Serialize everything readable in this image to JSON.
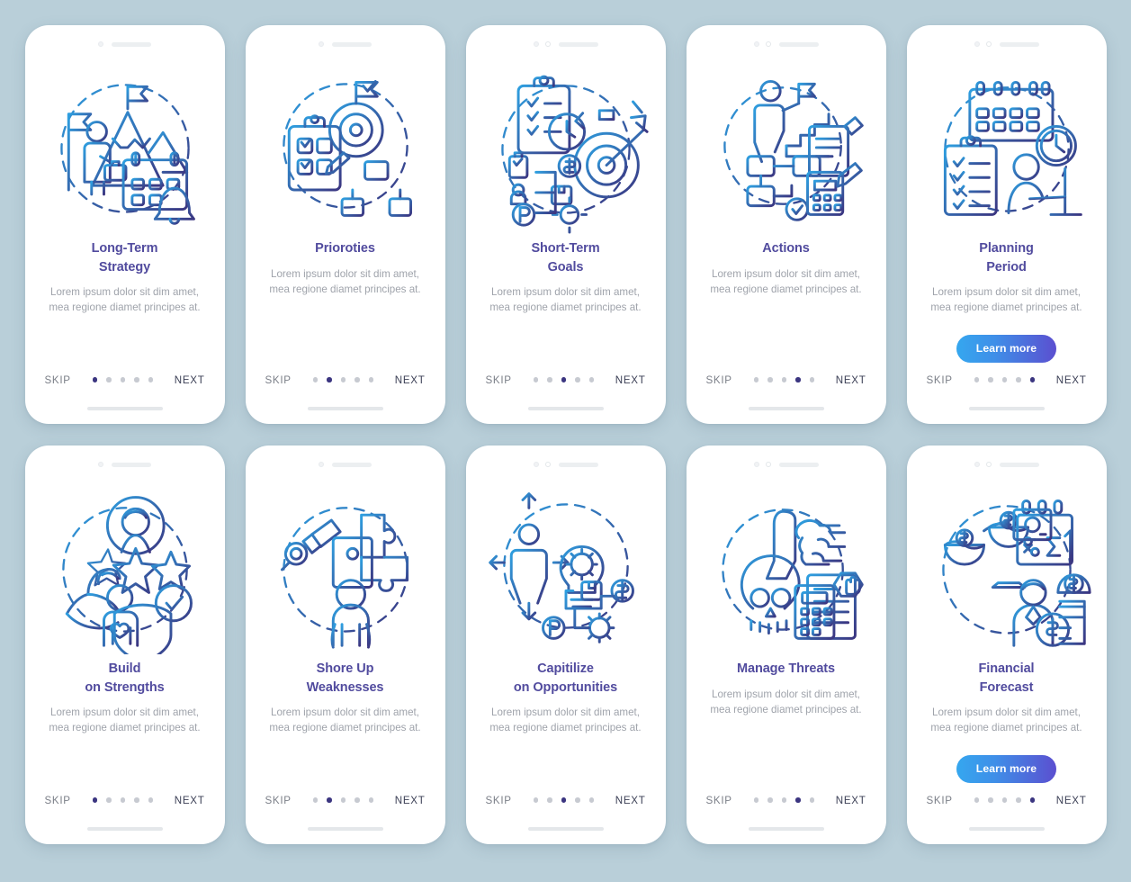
{
  "page": {
    "background_color": "#b9cfd9",
    "card_background": "#ffffff",
    "title_color": "#514b9e",
    "desc_color": "#9fa3ab",
    "active_dot_color": "#3b3580",
    "inactive_dot_color": "#c7cad1",
    "cta_gradient_start": "#35a7ef",
    "cta_gradient_end": "#5b4fd0",
    "illustration_stroke_start": "#2e9fe0",
    "illustration_stroke_end": "#3b3580"
  },
  "common": {
    "skip_label": "SKIP",
    "next_label": "NEXT",
    "learn_more_label": "Learn more",
    "description": "Lorem ipsum dolor sit dim amet, mea regione diamet principes at.",
    "dot_count": 5
  },
  "screens": [
    {
      "id": "long-term-strategy",
      "title": "Long-Term Strategy",
      "title_lines": [
        "Long-Term",
        "Strategy"
      ],
      "description": "Lorem ipsum dolor sit dim amet, mea regione diamet principes at.",
      "skip_label": "SKIP",
      "next_label": "NEXT",
      "active_dot": 1,
      "dot_count": 5,
      "camera_dots": 1,
      "has_learn_more": false,
      "learn_more_label": "",
      "illustration": "mountain-flag-calendar-icon"
    },
    {
      "id": "prioroties",
      "title": "Prioroties",
      "title_lines": [
        "Prioroties"
      ],
      "description": "Lorem ipsum dolor sit dim amet, mea regione diamet principes at.",
      "skip_label": "SKIP",
      "next_label": "NEXT",
      "active_dot": 2,
      "dot_count": 5,
      "camera_dots": 1,
      "has_learn_more": false,
      "learn_more_label": "",
      "illustration": "target-flag-checklist-hierarchy-icon"
    },
    {
      "id": "short-term-goals",
      "title": "Short-Term Goals",
      "title_lines": [
        "Short-Term",
        "Goals"
      ],
      "description": "Lorem ipsum dolor sit dim amet, mea regione diamet principes at.",
      "skip_label": "SKIP",
      "next_label": "NEXT",
      "active_dot": 3,
      "dot_count": 5,
      "camera_dots": 2,
      "has_learn_more": false,
      "learn_more_label": "",
      "illustration": "clipboard-clock-stopwatch-target-icon"
    },
    {
      "id": "actions",
      "title": "Actions",
      "title_lines": [
        "Actions"
      ],
      "description": "Lorem ipsum dolor sit dim amet, mea regione diamet principes at.",
      "skip_label": "SKIP",
      "next_label": "NEXT",
      "active_dot": 4,
      "dot_count": 5,
      "camera_dots": 2,
      "has_learn_more": false,
      "learn_more_label": "",
      "illustration": "person-stairs-flowchart-notepad-icon"
    },
    {
      "id": "planning-period",
      "title": "Planning Period",
      "title_lines": [
        "Planning",
        "Period"
      ],
      "description": "Lorem ipsum dolor sit dim amet, mea regione diamet principes at.",
      "skip_label": "SKIP",
      "next_label": "NEXT",
      "active_dot": 5,
      "dot_count": 5,
      "camera_dots": 2,
      "has_learn_more": true,
      "learn_more_label": "Learn more",
      "illustration": "calendar-clipboard-clock-desk-icon"
    },
    {
      "id": "build-on-strengths",
      "title": "Build on Strengths",
      "title_lines": [
        "Build",
        "on Strengths"
      ],
      "description": "Lorem ipsum dolor sit dim amet, mea regione diamet principes at.",
      "skip_label": "SKIP",
      "next_label": "NEXT",
      "active_dot": 1,
      "dot_count": 5,
      "camera_dots": 1,
      "has_learn_more": false,
      "learn_more_label": "",
      "illustration": "muscle-stars-shield-icon"
    },
    {
      "id": "shore-up-weaknesses",
      "title": "Shore Up Weaknesses",
      "title_lines": [
        "Shore Up",
        "Weaknesses"
      ],
      "description": "Lorem ipsum dolor sit dim amet, mea regione diamet principes at.",
      "skip_label": "SKIP",
      "next_label": "NEXT",
      "active_dot": 2,
      "dot_count": 5,
      "camera_dots": 1,
      "has_learn_more": false,
      "learn_more_label": "",
      "illustration": "puzzle-magnifier-person-icon"
    },
    {
      "id": "capitilize-on-opportunities",
      "title": "Capitilize on Opportunities",
      "title_lines": [
        "Capitilize",
        "on Opportunities"
      ],
      "description": "Lorem ipsum dolor sit dim amet, mea regione diamet principes at.",
      "skip_label": "SKIP",
      "next_label": "NEXT",
      "active_dot": 3,
      "dot_count": 5,
      "camera_dots": 2,
      "has_learn_more": false,
      "learn_more_label": "",
      "illustration": "person-arrows-lightbulb-gear-icon"
    },
    {
      "id": "manage-threats",
      "title": "Manage Threats",
      "title_lines": [
        "Manage Threats"
      ],
      "description": "Lorem ipsum dolor sit dim amet, mea regione diamet principes at.",
      "skip_label": "SKIP",
      "next_label": "NEXT",
      "active_dot": 4,
      "dot_count": 5,
      "camera_dots": 2,
      "has_learn_more": false,
      "learn_more_label": "",
      "illustration": "skull-hand-calculator-document-icon"
    },
    {
      "id": "financial-forecast",
      "title": "Financial Forecast",
      "title_lines": [
        "Financial",
        "Forecast"
      ],
      "description": "Lorem ipsum dolor sit dim amet, mea regione diamet principes at.",
      "skip_label": "SKIP",
      "next_label": "NEXT",
      "active_dot": 5,
      "dot_count": 5,
      "camera_dots": 2,
      "has_learn_more": true,
      "learn_more_label": "Learn more",
      "illustration": "scales-money-calendar-banker-icon"
    }
  ]
}
